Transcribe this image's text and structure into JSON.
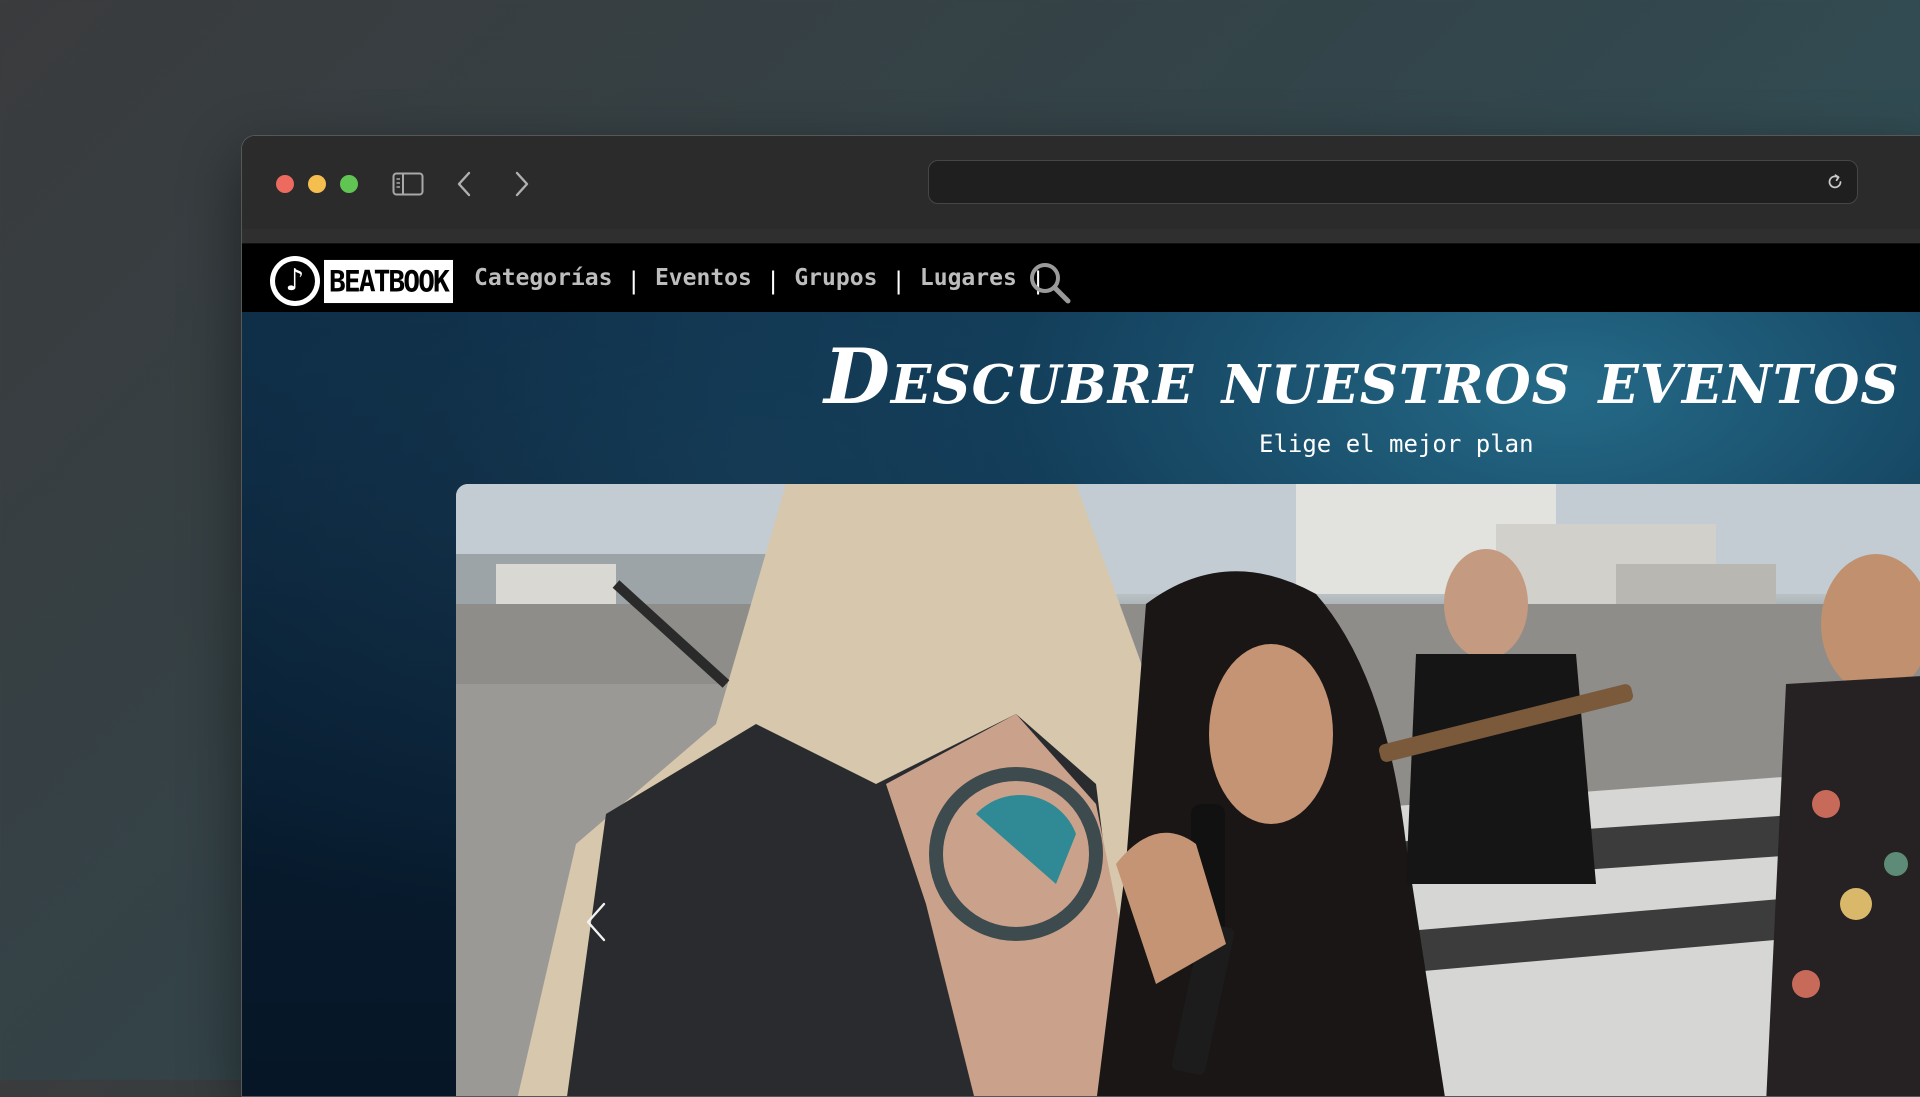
{
  "browser": {
    "url": "",
    "icons": {
      "sidebar": "sidebar-toggle-icon",
      "back": "chevron-left-icon",
      "forward": "chevron-right-icon",
      "reload": "reload-icon"
    }
  },
  "site": {
    "logo_text": "BEATBOOK",
    "logo_glyph": "♪",
    "nav": {
      "items": [
        {
          "label": "Categorías"
        },
        {
          "label": "Eventos"
        },
        {
          "label": "Grupos"
        },
        {
          "label": "Lugares"
        }
      ],
      "separator": "|",
      "search_icon": "search-icon"
    },
    "hero": {
      "title": "Descubre nuestros eventos",
      "subtitle": "Elige el mejor plan"
    },
    "carousel": {
      "prev_icon": "chevron-left-icon"
    }
  },
  "colors": {
    "nav_bg": "#000000",
    "nav_text": "#bdbdbd",
    "hero_bg": "#0b2a44",
    "hero_text": "#ffffff"
  }
}
